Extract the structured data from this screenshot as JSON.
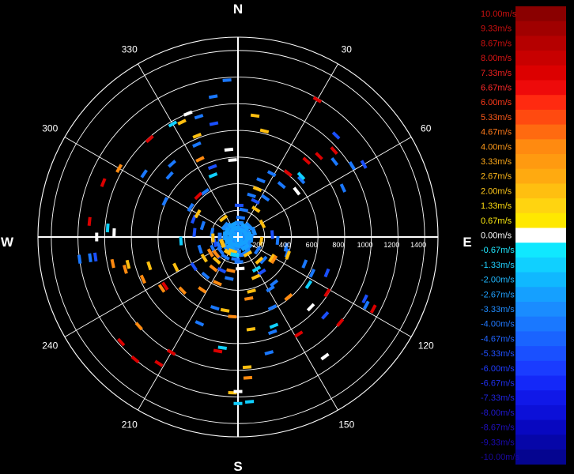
{
  "chart_data": {
    "type": "scatter",
    "subtype": "polar-radial-velocity-ppi",
    "angular_axis": {
      "direction": "clockwise",
      "zero": "north",
      "cardinal_labels": [
        "N",
        "E",
        "S",
        "W"
      ],
      "bearing_labels": [
        "30",
        "60",
        "120",
        "150",
        "210",
        "240",
        "300",
        "330"
      ],
      "bearings": [
        30,
        60,
        120,
        150,
        210,
        240,
        300,
        330
      ]
    },
    "radial_axis": {
      "range": [
        0,
        1500
      ],
      "rings": [
        200,
        400,
        600,
        800,
        1000,
        1200,
        1400
      ],
      "tick_labels": [
        "200",
        "400",
        "600",
        "800",
        "1000",
        "1200",
        "1400"
      ],
      "labeled_along": "east"
    },
    "grid": true,
    "legend": {
      "placement": "right",
      "labels": [
        "10.00m/s",
        "9.33m/s",
        "8.67m/s",
        "8.00m/s",
        "7.33m/s",
        "6.67m/s",
        "6.00m/s",
        "5.33m/s",
        "4.67m/s",
        "4.00m/s",
        "3.33m/s",
        "2.67m/s",
        "2.00m/s",
        "1.33m/s",
        "0.67m/s",
        "0.00m/s",
        "-0.67m/s",
        "-1.33m/s",
        "-2.00m/s",
        "-2.67m/s",
        "-3.33m/s",
        "-4.00m/s",
        "-4.67m/s",
        "-5.33m/s",
        "-6.00m/s",
        "-6.67m/s",
        "-7.33m/s",
        "-8.00m/s",
        "-8.67m/s",
        "-9.33m/s",
        "-10.00m/s"
      ],
      "colors": [
        "#8a0000",
        "#a00000",
        "#b50000",
        "#c80000",
        "#dc0000",
        "#ee0a0a",
        "#ff2a10",
        "#ff4a10",
        "#ff6a10",
        "#ff8a10",
        "#ff9a10",
        "#ffaa10",
        "#ffbf10",
        "#ffd410",
        "#ffe800",
        "#ffffff",
        "#10e8ff",
        "#10d0ff",
        "#10b8ff",
        "#15a0ff",
        "#1a8cff",
        "#1a78ff",
        "#1a64ff",
        "#1a50ff",
        "#1a3cff",
        "#1428f8",
        "#1018e8",
        "#0c10d8",
        "#0808c0",
        "#0606a8",
        "#050590"
      ],
      "label_colors": [
        "#cc1010",
        "#cc1010",
        "#cc1010",
        "#dd1515",
        "#ee2020",
        "#ff2a2a",
        "#ff3a1a",
        "#ff5a1a",
        "#ff7a1a",
        "#ff9a1a",
        "#ffaa1a",
        "#ffb81a",
        "#ffc81a",
        "#ffdc10",
        "#ffec10",
        "#ffffff",
        "#20e8ff",
        "#20d0ff",
        "#20b8ff",
        "#20a0ff",
        "#208cff",
        "#2078ff",
        "#2064ff",
        "#2050ff",
        "#203cff",
        "#2030f0",
        "#2024e0",
        "#2018d0",
        "#2010c0",
        "#1a0ab0",
        "#1a08a0"
      ],
      "units": "m/s",
      "range": [
        -10,
        10
      ]
    },
    "series": [
      {
        "velocity": -3.2,
        "points": [
          [
            0,
            20
          ],
          [
            10,
            30
          ],
          [
            25,
            40
          ],
          [
            40,
            55
          ],
          [
            60,
            45
          ],
          [
            80,
            60
          ],
          [
            100,
            40
          ],
          [
            120,
            70
          ],
          [
            140,
            55
          ],
          [
            160,
            50
          ],
          [
            180,
            60
          ],
          [
            200,
            45
          ],
          [
            220,
            55
          ],
          [
            240,
            65
          ],
          [
            260,
            50
          ],
          [
            280,
            60
          ],
          [
            300,
            45
          ],
          [
            320,
            55
          ],
          [
            340,
            60
          ],
          [
            355,
            35
          ],
          [
            15,
            80
          ],
          [
            50,
            90
          ],
          [
            90,
            85
          ],
          [
            130,
            95
          ],
          [
            170,
            80
          ],
          [
            210,
            90
          ],
          [
            250,
            85
          ],
          [
            290,
            95
          ],
          [
            330,
            90
          ],
          [
            5,
            110
          ],
          [
            45,
            120
          ],
          [
            95,
            105
          ],
          [
            135,
            115
          ],
          [
            185,
            110
          ],
          [
            225,
            120
          ],
          [
            275,
            105
          ],
          [
            315,
            115
          ],
          [
            70,
            130
          ],
          [
            150,
            135
          ],
          [
            230,
            125
          ],
          [
            310,
            130
          ]
        ]
      },
      {
        "velocity": -2.4,
        "points": [
          [
            30,
            25
          ],
          [
            75,
            35
          ],
          [
            115,
            30
          ],
          [
            165,
            40
          ],
          [
            205,
            30
          ],
          [
            245,
            35
          ],
          [
            285,
            40
          ],
          [
            325,
            30
          ],
          [
            20,
            65
          ],
          [
            65,
            70
          ],
          [
            110,
            75
          ],
          [
            155,
            65
          ],
          [
            195,
            70
          ],
          [
            235,
            75
          ],
          [
            265,
            65
          ],
          [
            305,
            70
          ],
          [
            345,
            75
          ],
          [
            35,
            100
          ],
          [
            85,
            95
          ],
          [
            145,
            100
          ],
          [
            215,
            100
          ],
          [
            255,
            95
          ],
          [
            295,
            100
          ],
          [
            335,
            105
          ]
        ]
      },
      {
        "velocity": -4.2,
        "points": [
          [
            8,
            150
          ],
          [
            12,
            210
          ],
          [
            18,
            330
          ],
          [
            22,
            460
          ],
          [
            28,
            540
          ],
          [
            35,
            360
          ],
          [
            40,
            510
          ],
          [
            48,
            640
          ],
          [
            52,
            920
          ],
          [
            58,
            1010
          ],
          [
            65,
            870
          ],
          [
            95,
            300
          ],
          [
            102,
            370
          ],
          [
            108,
            390
          ],
          [
            112,
            540
          ],
          [
            116,
            620
          ],
          [
            118,
            1090
          ],
          [
            124,
            180
          ],
          [
            132,
            260
          ],
          [
            142,
            440
          ],
          [
            148,
            460
          ],
          [
            154,
            590
          ],
          [
            160,
            760
          ],
          [
            165,
            900
          ],
          [
            172,
            140
          ],
          [
            178,
            190
          ],
          [
            186,
            170
          ],
          [
            192,
            320
          ],
          [
            198,
            560
          ],
          [
            204,
            710
          ],
          [
            212,
            180
          ],
          [
            220,
            380
          ],
          [
            232,
            170
          ],
          [
            244,
            210
          ],
          [
            252,
            300
          ],
          [
            262,
            1120
          ],
          [
            270,
            140
          ],
          [
            280,
            200
          ],
          [
            288,
            280
          ],
          [
            296,
            610
          ],
          [
            304,
            850
          ],
          [
            312,
            690
          ],
          [
            318,
            740
          ],
          [
            324,
            420
          ],
          [
            336,
            760
          ],
          [
            342,
            950
          ],
          [
            350,
            1070
          ],
          [
            356,
            1180
          ],
          [
            302,
            420
          ],
          [
            246,
            160
          ],
          [
            262,
            1200
          ]
        ]
      },
      {
        "velocity": -5.4,
        "points": [
          [
            44,
            1060
          ],
          [
            60,
            1090
          ],
          [
            112,
            720
          ],
          [
            116,
            1060
          ],
          [
            132,
            880
          ],
          [
            230,
            210
          ],
          [
            262,
            1080
          ],
          [
            340,
            560
          ],
          [
            348,
            870
          ],
          [
            2,
            240
          ],
          [
            26,
            300
          ],
          [
            86,
            260
          ],
          [
            146,
            320
          ],
          [
            206,
            280
          ],
          [
            236,
            400
          ],
          [
            256,
            180
          ],
          [
            276,
            330
          ],
          [
            292,
            360
          ]
        ]
      },
      {
        "velocity": 1.8,
        "points": [
          [
            8,
            920
          ],
          [
            14,
            820
          ],
          [
            22,
            390
          ],
          [
            33,
            250
          ],
          [
            62,
            210
          ],
          [
            110,
            400
          ],
          [
            122,
            300
          ],
          [
            138,
            240
          ],
          [
            156,
            330
          ],
          [
            166,
            420
          ],
          [
            172,
            700
          ],
          [
            176,
            980
          ],
          [
            182,
            1170
          ],
          [
            190,
            560
          ],
          [
            212,
            140
          ],
          [
            222,
            240
          ],
          [
            238,
            300
          ],
          [
            244,
            520
          ],
          [
            252,
            700
          ],
          [
            256,
            850
          ],
          [
            268,
            190
          ],
          [
            300,
            350
          ],
          [
            322,
            180
          ],
          [
            334,
            960
          ],
          [
            338,
            820
          ],
          [
            200,
            120
          ],
          [
            150,
            150
          ],
          [
            100,
            180
          ],
          [
            248,
            130
          ]
        ]
      },
      {
        "velocity": 4.0,
        "points": [
          [
            192,
            260
          ],
          [
            204,
            380
          ],
          [
            214,
            480
          ],
          [
            226,
            580
          ],
          [
            236,
            690
          ],
          [
            246,
            780
          ],
          [
            254,
            880
          ],
          [
            258,
            960
          ],
          [
            232,
            210
          ],
          [
            218,
            300
          ],
          [
            240,
            240
          ],
          [
            170,
            470
          ],
          [
            184,
            600
          ],
          [
            334,
            650
          ],
          [
            300,
            1030
          ],
          [
            122,
            320
          ],
          [
            140,
            590
          ],
          [
            176,
            1060
          ],
          [
            228,
            1000
          ]
        ]
      },
      {
        "velocity": 7.3,
        "points": [
          [
            30,
            1190
          ],
          [
            38,
            610
          ],
          [
            42,
            770
          ],
          [
            45,
            860
          ],
          [
            48,
            970
          ],
          [
            122,
            790
          ],
          [
            130,
            1000
          ],
          [
            148,
            860
          ],
          [
            190,
            870
          ],
          [
            210,
            1000
          ],
          [
            212,
            1120
          ],
          [
            220,
            1200
          ],
          [
            228,
            1180
          ],
          [
            276,
            1120
          ],
          [
            292,
            1090
          ],
          [
            316,
            430
          ],
          [
            318,
            990
          ],
          [
            236,
            660
          ],
          [
            118,
            1150
          ]
        ]
      },
      {
        "velocity": 0.0,
        "points": [
          [
            52,
            560
          ],
          [
            134,
            760
          ],
          [
            144,
            1110
          ],
          [
            180,
            1160
          ],
          [
            338,
            1000
          ],
          [
            354,
            660
          ],
          [
            356,
            580
          ],
          [
            176,
            240
          ],
          [
            270,
            1060
          ],
          [
            272,
            930
          ]
        ]
      },
      {
        "velocity": -1.5,
        "points": [
          [
            46,
            660
          ],
          [
            124,
            640
          ],
          [
            150,
            280
          ],
          [
            158,
            720
          ],
          [
            188,
            840
          ],
          [
            176,
            1240
          ],
          [
            180,
            1250
          ],
          [
            190,
            140
          ],
          [
            330,
            980
          ],
          [
            338,
            500
          ],
          [
            266,
            430
          ],
          [
            274,
            980
          ]
        ]
      }
    ]
  }
}
